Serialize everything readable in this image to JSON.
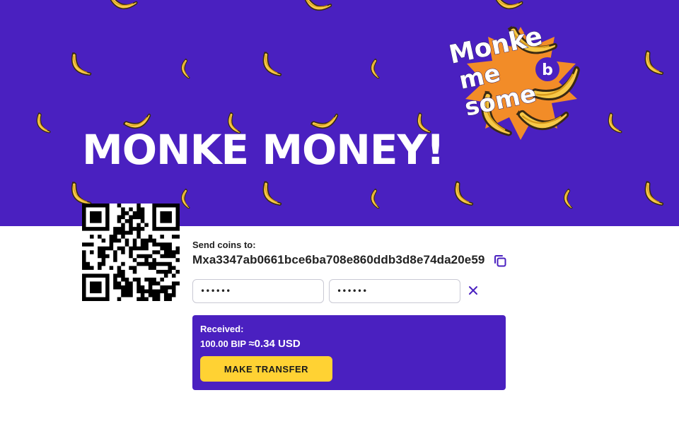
{
  "hero": {
    "title": "MONKE MONEY!",
    "sticker": {
      "line1": "Monke",
      "line2": "me",
      "line3": "some",
      "badge": "b"
    }
  },
  "wallet": {
    "send_label": "Send coins to:",
    "address": "Mxa3347ab0661bce6ba708e860ddb3d8e74da20e59",
    "password1_value": "••••••",
    "password2_value": "••••••"
  },
  "panel": {
    "received_label": "Received:",
    "amount": "100.00 BIP",
    "usd": "≈0.34 USD",
    "button_label": "MAKE TRANSFER"
  },
  "colors": {
    "brand": "#4a20c0",
    "accent": "#ffd233",
    "sticker": "#f28c28"
  },
  "icons": [
    "banana-icon",
    "copy-icon",
    "close-icon",
    "qr-code"
  ]
}
